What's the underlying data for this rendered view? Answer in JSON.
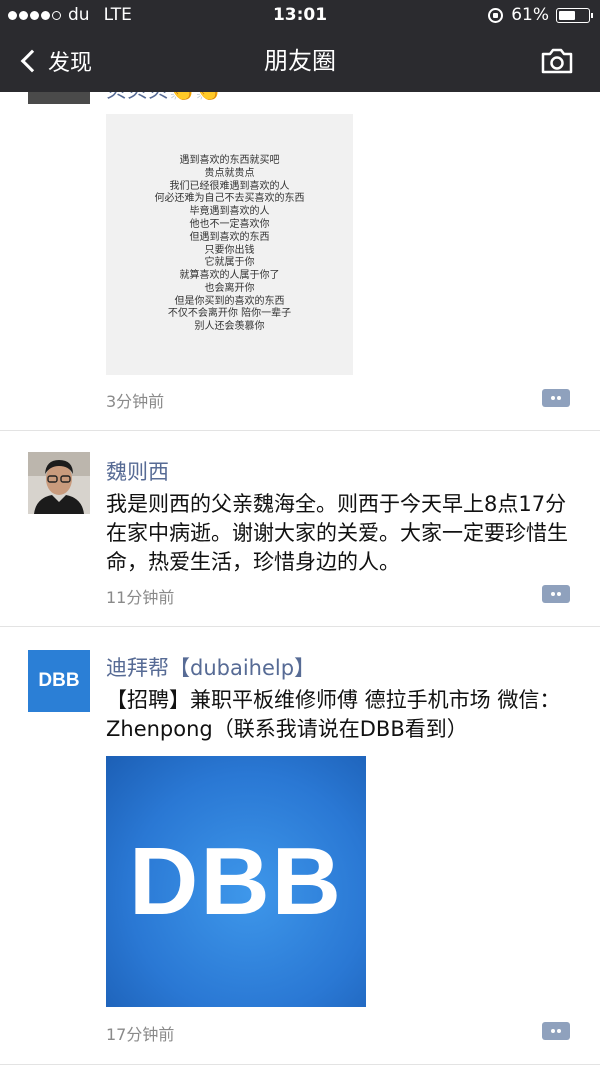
{
  "status_bar": {
    "carrier": "du",
    "network": "LTE",
    "time": "13:01",
    "battery_percent": "61%",
    "battery_level": 0.61,
    "signal_bars": 4
  },
  "nav": {
    "back_label": "发现",
    "title": "朋友圈",
    "camera_icon": "camera-icon"
  },
  "posts": [
    {
      "name_partial": "贝贝贝👏👏",
      "image_lines": [
        "遇到喜欢的东西就买吧",
        "贵点就贵点",
        "我们已经很难遇到喜欢的人",
        "何必还难为自己不去买喜欢的东西",
        "毕竟遇到喜欢的人",
        "他也不一定喜欢你",
        "但遇到喜欢的东西",
        "只要你出钱",
        "它就属于你",
        "就算喜欢的人属于你了",
        "也会离开你",
        "但是你买到的喜欢的东西",
        "不仅不会离开你 陪你一辈子",
        "别人还会羡慕你"
      ],
      "time": "3分钟前"
    },
    {
      "name": "魏则西",
      "text": "我是则西的父亲魏海全。则西于今天早上8点17分在家中病逝。谢谢大家的关爱。大家一定要珍惜生命，热爱生活，珍惜身边的人。",
      "time": "11分钟前"
    },
    {
      "name": "迪拜帮【dubaihelp】",
      "avatar_text": "DBB",
      "text": "【招聘】兼职平板维修师傅 德拉手机市场 微信：Zhenpong（联系我请说在DBB看到）",
      "image_text": "DBB",
      "time": "17分钟前"
    }
  ],
  "colors": {
    "header_bg": "#2b2b2f",
    "name_color": "#576b95",
    "dbb_blue": "#2b7fd6"
  }
}
